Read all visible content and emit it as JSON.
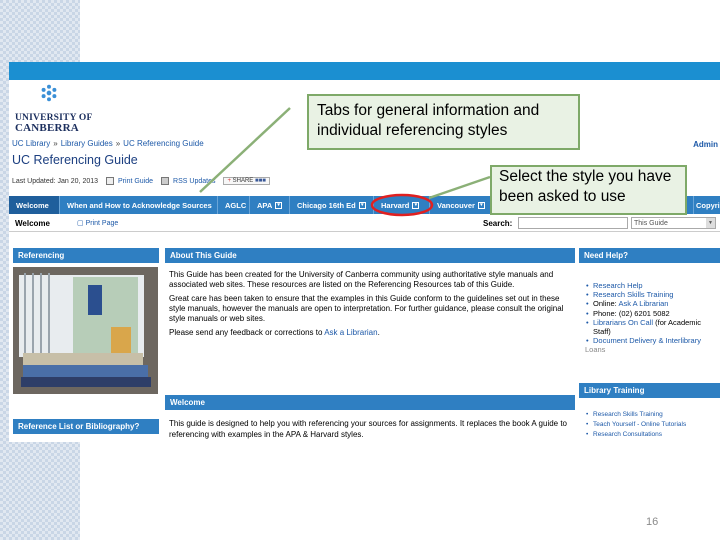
{
  "university": {
    "line1": "UNIVERSITY OF",
    "line2": "CANBERRA"
  },
  "admin_label": "Admin",
  "breadcrumb": [
    "UC Library",
    "Library Guides",
    "UC Referencing Guide"
  ],
  "breadcrumb_sep": "»",
  "page_title": "UC Referencing Guide",
  "last_updated": "Last Updated: Jan 20, 2013",
  "print_guide": "Print Guide",
  "rss_updates": "RSS Updates",
  "share_label": "SHARE",
  "tabs": [
    {
      "label": "Welcome",
      "dropdown": false
    },
    {
      "label": "When and How to Acknowledge Sources",
      "dropdown": false
    },
    {
      "label": "AGLC",
      "dropdown": false
    },
    {
      "label": "APA",
      "dropdown": true
    },
    {
      "label": "Chicago 16th Ed",
      "dropdown": true
    },
    {
      "label": "Harvard",
      "dropdown": true
    },
    {
      "label": "Vancouver",
      "dropdown": true
    },
    {
      "label": "Copyri",
      "dropdown": false
    }
  ],
  "subbar": {
    "welcome": "Welcome",
    "print_page": "Print Page",
    "search_label": "Search:",
    "search_value": "",
    "search_scope": "This Guide"
  },
  "boxes": {
    "referencing": "Referencing",
    "about": "About This Guide",
    "need_help": "Need Help?",
    "library_training": "Library Training",
    "welcome": "Welcome",
    "reference_list": "Reference List or Bibliography?"
  },
  "about": {
    "p1": "This Guide has been created for the University of Canberra community using authoritative style manuals and associated web sites. These resources are listed on the Referencing Resources tab of this Guide.",
    "p2": "Great care has been taken to ensure that the examples in this Guide conform to the guidelines set out in these style manuals, however the manuals are open to interpretation. For further guidance, please consult the original style manuals or web sites.",
    "p3_prefix": "Please send any feedback or corrections to ",
    "p3_link": "Ask a Librarian",
    "p3_suffix": "."
  },
  "help": {
    "research_help": "Research Help",
    "research_skills": "Research Skills Training",
    "online_prefix": "Online: ",
    "online_link": "Ask A Librarian",
    "phone": "Phone: (02) 6201 5082",
    "oncall_link": "Librarians On Call",
    "oncall_suffix": " (for Academic Staff)",
    "delivery": "Document Delivery & Interlibrary",
    "loans": "Loans"
  },
  "training": [
    "Research Skills Training",
    "Teach Yourself - Online Tutorials",
    "Research Consultations"
  ],
  "welcome_text": "This guide is designed to help you with referencing your sources for assignments. It replaces the book A guide to referencing with examples in the APA & Harvard styles.",
  "callouts": {
    "tabs": "Tabs for general information and individual referencing styles",
    "style": "Select the style you have been asked to use"
  },
  "slide_number": "16",
  "colors": {
    "accent": "#2f7fc2",
    "callout_border": "#7ea968",
    "highlight": "#e02020"
  }
}
